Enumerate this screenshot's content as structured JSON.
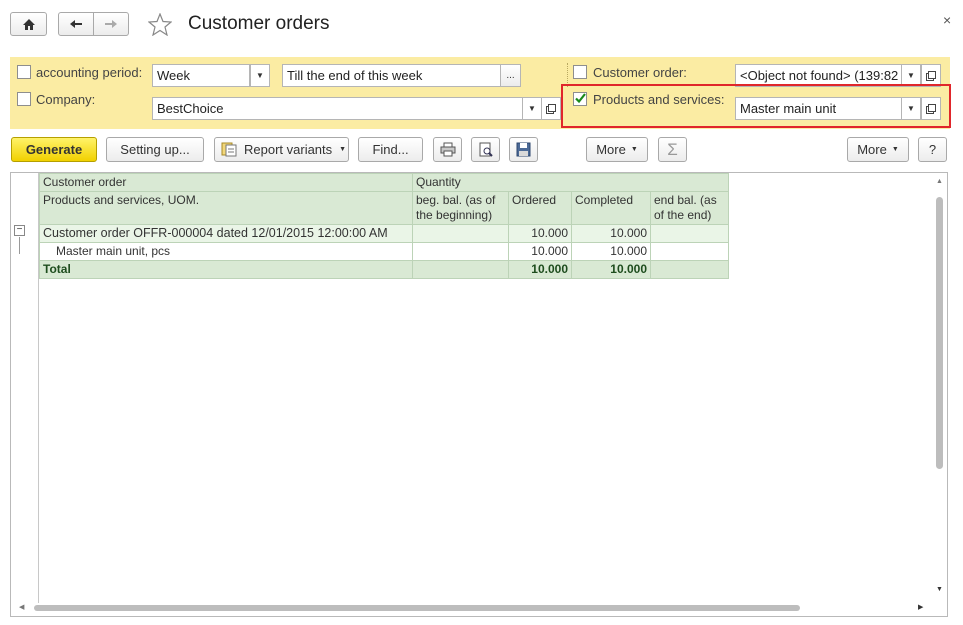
{
  "window": {
    "title": "Customer orders",
    "close_glyph": "×"
  },
  "nav": {
    "home_icon": "home-icon",
    "back_icon": "arrow-left-icon",
    "forward_icon": "arrow-right-icon",
    "favorite_icon": "star-icon"
  },
  "filters": {
    "accounting_period": {
      "label": "accounting period:",
      "checked": false,
      "period_value": "Week",
      "end_value": "Till the end of this week",
      "ellipsis": "..."
    },
    "company": {
      "label": "Company:",
      "checked": false,
      "value": "BestChoice"
    },
    "customer_order": {
      "label": "Customer order:",
      "checked": false,
      "value": "<Object not found> (139:82"
    },
    "products_services": {
      "label": "Products and services:",
      "checked": true,
      "value": "Master main unit"
    }
  },
  "toolbar": {
    "generate": "Generate",
    "setting_up": "Setting up...",
    "report_variants": "Report variants",
    "find": "Find...",
    "more_1": "More",
    "more_2": "More",
    "help": "?",
    "sigma": "Σ"
  },
  "report": {
    "headers": {
      "customer_order": "Customer order",
      "products_uom": "Products and services, UOM.",
      "quantity": "Quantity",
      "beg_bal": "beg. bal. (as of the beginning)",
      "ordered": "Ordered",
      "completed": "Completed",
      "end_bal": "end bal. (as of the end)"
    },
    "group_row": {
      "label": "Customer order OFFR-000004 dated 12/01/2015 12:00:00 AM",
      "beg": "",
      "ordered": "10.000",
      "completed": "10.000",
      "end": ""
    },
    "detail_row": {
      "label": "Master main unit, pcs",
      "beg": "",
      "ordered": "10.000",
      "completed": "10.000",
      "end": ""
    },
    "total_row": {
      "label": "Total",
      "beg": "",
      "ordered": "10.000",
      "completed": "10.000",
      "end": ""
    },
    "collapse_glyph": "−"
  },
  "colors": {
    "filter_bg": "#fbeca3",
    "generate_bg": "#f1d100",
    "highlight_border": "#e0262b",
    "table_header": "#d9e9d4"
  }
}
